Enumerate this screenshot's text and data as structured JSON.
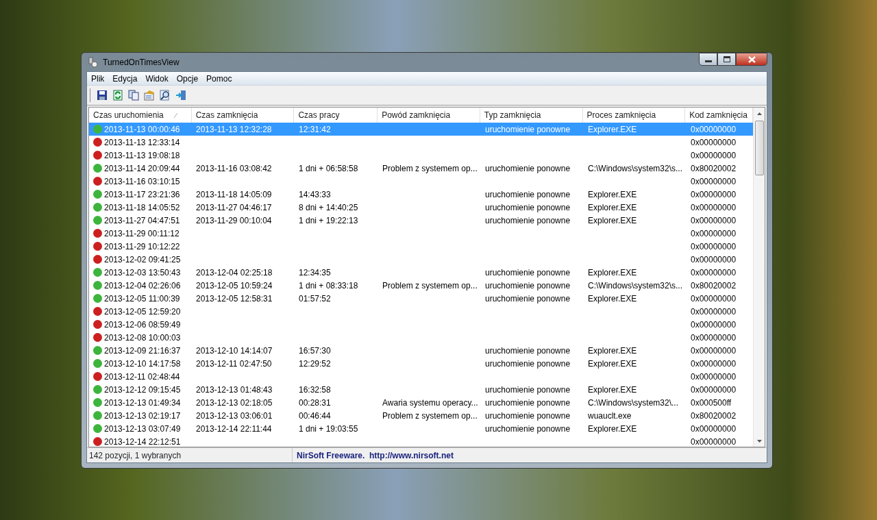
{
  "window": {
    "title": "TurnedOnTimesView"
  },
  "menu": [
    "Plik",
    "Edycja",
    "Widok",
    "Opcje",
    "Pomoc"
  ],
  "toolbar": [
    {
      "kind": "save"
    },
    {
      "kind": "refresh"
    },
    {
      "kind": "copy"
    },
    {
      "kind": "properties"
    },
    {
      "kind": "find"
    },
    {
      "kind": "exit"
    }
  ],
  "table": {
    "columns": [
      {
        "label": "Czas uruchomienia",
        "sorted": true
      },
      {
        "label": "Czas zamknięcia",
        "sorted": false
      },
      {
        "label": "Czas pracy",
        "sorted": false
      },
      {
        "label": "Powód zamknięcia",
        "sorted": false
      },
      {
        "label": "Typ zamknięcia",
        "sorted": false
      },
      {
        "label": "Proces zamknięcia",
        "sorted": false
      },
      {
        "label": "Kod zamknięcia",
        "sorted": false
      }
    ],
    "rows": [
      {
        "selected": true,
        "color": "#3db53d",
        "cells": [
          "2013-11-13 00:00:46",
          "2013-11-13 12:32:28",
          "12:31:42",
          null,
          "uruchomienie ponowne",
          "Explorer.EXE",
          "0x00000000"
        ]
      },
      {
        "selected": false,
        "color": "#cc2020",
        "cells": [
          "2013-11-13 12:33:14",
          null,
          null,
          null,
          null,
          null,
          "0x00000000"
        ]
      },
      {
        "selected": false,
        "color": "#cc2020",
        "cells": [
          "2013-11-13 19:08:18",
          null,
          null,
          null,
          null,
          null,
          "0x00000000"
        ]
      },
      {
        "selected": false,
        "color": "#3db53d",
        "cells": [
          "2013-11-14 20:09:44",
          "2013-11-16 03:08:42",
          "1 dni + 06:58:58",
          "Problem z systemem op...",
          "uruchomienie ponowne",
          "C:\\Windows\\system32\\s...",
          "0x80020002"
        ]
      },
      {
        "selected": false,
        "color": "#cc2020",
        "cells": [
          "2013-11-16 03:10:15",
          null,
          null,
          null,
          null,
          null,
          "0x00000000"
        ]
      },
      {
        "selected": false,
        "color": "#3db53d",
        "cells": [
          "2013-11-17 23:21:36",
          "2013-11-18 14:05:09",
          "14:43:33",
          null,
          "uruchomienie ponowne",
          "Explorer.EXE",
          "0x00000000"
        ]
      },
      {
        "selected": false,
        "color": "#3db53d",
        "cells": [
          "2013-11-18 14:05:52",
          "2013-11-27 04:46:17",
          "8 dni + 14:40:25",
          null,
          "uruchomienie ponowne",
          "Explorer.EXE",
          "0x00000000"
        ]
      },
      {
        "selected": false,
        "color": "#3db53d",
        "cells": [
          "2013-11-27 04:47:51",
          "2013-11-29 00:10:04",
          "1 dni + 19:22:13",
          null,
          "uruchomienie ponowne",
          "Explorer.EXE",
          "0x00000000"
        ]
      },
      {
        "selected": false,
        "color": "#cc2020",
        "cells": [
          "2013-11-29 00:11:12",
          null,
          null,
          null,
          null,
          null,
          "0x00000000"
        ]
      },
      {
        "selected": false,
        "color": "#cc2020",
        "cells": [
          "2013-11-29 10:12:22",
          null,
          null,
          null,
          null,
          null,
          "0x00000000"
        ]
      },
      {
        "selected": false,
        "color": "#cc2020",
        "cells": [
          "2013-12-02 09:41:25",
          null,
          null,
          null,
          null,
          null,
          "0x00000000"
        ]
      },
      {
        "selected": false,
        "color": "#3db53d",
        "cells": [
          "2013-12-03 13:50:43",
          "2013-12-04 02:25:18",
          "12:34:35",
          null,
          "uruchomienie ponowne",
          "Explorer.EXE",
          "0x00000000"
        ]
      },
      {
        "selected": false,
        "color": "#3db53d",
        "cells": [
          "2013-12-04 02:26:06",
          "2013-12-05 10:59:24",
          "1 dni + 08:33:18",
          "Problem z systemem op...",
          "uruchomienie ponowne",
          "C:\\Windows\\system32\\s...",
          "0x80020002"
        ]
      },
      {
        "selected": false,
        "color": "#3db53d",
        "cells": [
          "2013-12-05 11:00:39",
          "2013-12-05 12:58:31",
          "01:57:52",
          null,
          "uruchomienie ponowne",
          "Explorer.EXE",
          "0x00000000"
        ]
      },
      {
        "selected": false,
        "color": "#cc2020",
        "cells": [
          "2013-12-05 12:59:20",
          null,
          null,
          null,
          null,
          null,
          "0x00000000"
        ]
      },
      {
        "selected": false,
        "color": "#cc2020",
        "cells": [
          "2013-12-06 08:59:49",
          null,
          null,
          null,
          null,
          null,
          "0x00000000"
        ]
      },
      {
        "selected": false,
        "color": "#cc2020",
        "cells": [
          "2013-12-08 10:00:03",
          null,
          null,
          null,
          null,
          null,
          "0x00000000"
        ]
      },
      {
        "selected": false,
        "color": "#3db53d",
        "cells": [
          "2013-12-09 21:16:37",
          "2013-12-10 14:14:07",
          "16:57:30",
          null,
          "uruchomienie ponowne",
          "Explorer.EXE",
          "0x00000000"
        ]
      },
      {
        "selected": false,
        "color": "#3db53d",
        "cells": [
          "2013-12-10 14:17:58",
          "2013-12-11 02:47:50",
          "12:29:52",
          null,
          "uruchomienie ponowne",
          "Explorer.EXE",
          "0x00000000"
        ]
      },
      {
        "selected": false,
        "color": "#cc2020",
        "cells": [
          "2013-12-11 02:48:44",
          null,
          null,
          null,
          null,
          null,
          "0x00000000"
        ]
      },
      {
        "selected": false,
        "color": "#3db53d",
        "cells": [
          "2013-12-12 09:15:45",
          "2013-12-13 01:48:43",
          "16:32:58",
          null,
          "uruchomienie ponowne",
          "Explorer.EXE",
          "0x00000000"
        ]
      },
      {
        "selected": false,
        "color": "#3db53d",
        "cells": [
          "2013-12-13 01:49:34",
          "2013-12-13 02:18:05",
          "00:28:31",
          "Awaria systemu operacy...",
          "uruchomienie ponowne",
          "C:\\Windows\\system32\\...",
          "0x000500ff"
        ]
      },
      {
        "selected": false,
        "color": "#3db53d",
        "cells": [
          "2013-12-13 02:19:17",
          "2013-12-13 03:06:01",
          "00:46:44",
          "Problem z systemem op...",
          "uruchomienie ponowne",
          "wuauclt.exe",
          "0x80020002"
        ]
      },
      {
        "selected": false,
        "color": "#3db53d",
        "cells": [
          "2013-12-13 03:07:49",
          "2013-12-14 22:11:44",
          "1 dni + 19:03:55",
          null,
          "uruchomienie ponowne",
          "Explorer.EXE",
          "0x00000000"
        ]
      },
      {
        "selected": false,
        "color": "#cc2020",
        "cells": [
          "2013-12-14 22:12:51",
          null,
          null,
          null,
          null,
          null,
          "0x00000000"
        ]
      }
    ]
  },
  "status_bar": {
    "count": "142 pozycji, 1 wybranych",
    "credit": "NirSoft Freeware.  http://www.nirsoft.net"
  }
}
